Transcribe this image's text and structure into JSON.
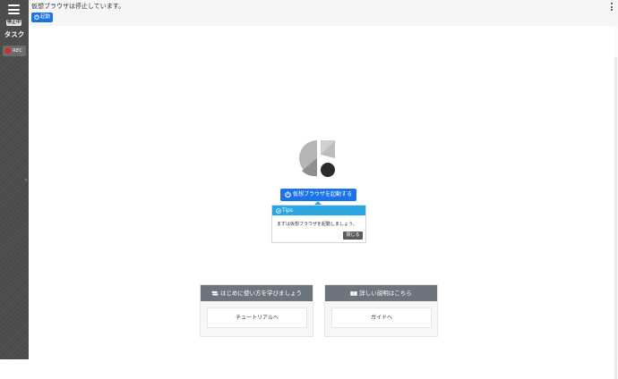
{
  "sidebar": {
    "status_badge": "停止中",
    "task_label": "タスク",
    "rec_label": "REC"
  },
  "topbar": {
    "status_message": "仮想ブラウザは停止しています。",
    "start_button_label": "起動"
  },
  "main": {
    "launch_button_label": "仮想ブラウザを起動する",
    "tips": {
      "title": "Tips",
      "message": "まずは仮想ブラウザを起動しましょう。",
      "close_label": "閉じる"
    },
    "cards": [
      {
        "header": "はじめに使い方を学びましょう",
        "link_label": "チュートリアルへ",
        "icon": "signpost-icon"
      },
      {
        "header": "詳しい説明はこちら",
        "link_label": "ガイドへ",
        "icon": "book-icon"
      }
    ]
  },
  "colors": {
    "sidebar_bg": "#4a4a4a",
    "primary": "#1a73e8",
    "tips_header": "#2aa7e0",
    "card_header": "#6c757d",
    "rec_dot": "#e0251f"
  }
}
